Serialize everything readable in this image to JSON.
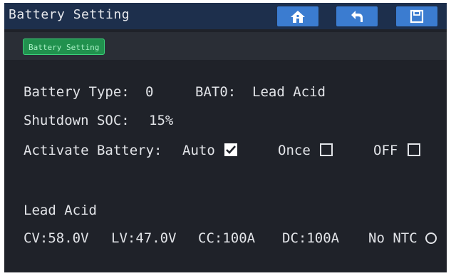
{
  "header": {
    "title": "Battery Setting",
    "icons": [
      "home-icon",
      "back-icon",
      "save-icon"
    ]
  },
  "tab": {
    "label": "Battery Setting"
  },
  "battery": {
    "type_label": "Battery Type:",
    "type_value": "0",
    "bat_label": "BAT0:",
    "bat_value": "Lead Acid",
    "shutdown_label": "Shutdown SOC:",
    "shutdown_value": "15%",
    "activate_label": "Activate Battery:",
    "options": [
      {
        "label": "Auto",
        "checked": true
      },
      {
        "label": "Once",
        "checked": false
      },
      {
        "label": "OFF",
        "checked": false
      }
    ]
  },
  "lead_acid": {
    "title": "Lead Acid",
    "cv": "CV:58.0V",
    "lv": "LV:47.0V",
    "cc": "CC:100A",
    "dc": "DC:100A",
    "ntc_label": "No NTC",
    "ntc_selected": false
  },
  "colors": {
    "header_bg": "#1d2f4c",
    "panel_bg": "#1f2229",
    "button": "#3b7cd0",
    "tab_green": "#21914e"
  }
}
